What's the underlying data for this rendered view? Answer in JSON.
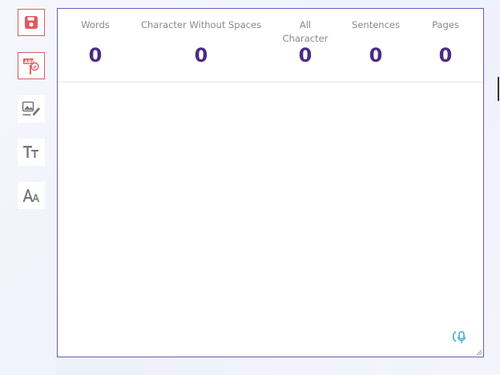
{
  "toolbar": {
    "save_icon": "floppy-disk-icon",
    "spellcheck_icon": "spellcheck-icon",
    "image_edit_icon": "image-edit-icon",
    "text_size_icon": "text-size-icon",
    "font_icon": "font-icon",
    "accent_color": "#e05a5e"
  },
  "stats": {
    "words": {
      "label": "Words",
      "value": "0"
    },
    "chars_no_spaces": {
      "label": "Character Without Spaces",
      "value": "0"
    },
    "all_chars": {
      "label": "All Character",
      "value": "0"
    },
    "sentences": {
      "label": "Sentences",
      "value": "0"
    },
    "pages": {
      "label": "Pages",
      "value": "0"
    }
  },
  "editor": {
    "text": "",
    "mic_icon": "microphone-icon",
    "border_color": "#6c5ab8",
    "value_color": "#4b2b85"
  }
}
